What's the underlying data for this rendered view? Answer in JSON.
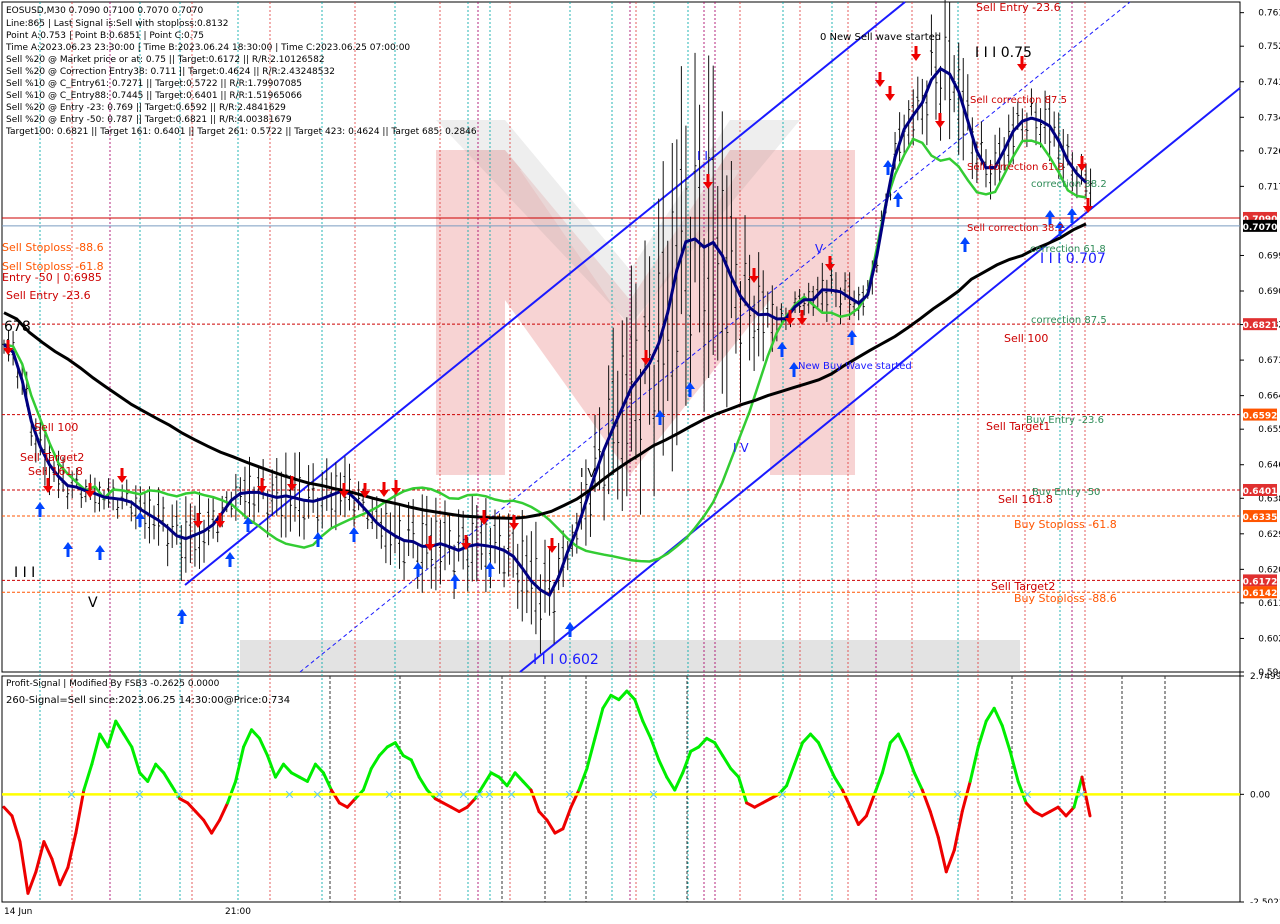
{
  "header": {
    "symbol_line": "EOSUSD,M30  0.7090 0.7100 0.7070 0.7070",
    "info_lines": [
      "Line:865 | Last Signal is:Sell with stoploss:0.8132",
      "Point A:0.753 | Point B:0.6851 | Point C:0.75",
      "Time A:2023.06.23 23:30:00 | Time B:2023.06.24 18:30:00 | Time C:2023.06.25 07:00:00",
      "Sell %20 @ Market price or at: 0.75 || Target:0.6172 || R/R:2.10126582",
      "Sell %20 @ Correction Entry38: 0.711 || Target:0.4624 || R/R:2.43248532",
      "Sell %10 @ C_Entry61: 0.7271 || Target:0.5722 || R/R:1.79907085",
      "Sell %10 @ C_Entry88: 0.7445 || Target:0.6401 || R/R:1.51965066",
      "Sell %20 @ Entry -23: 0.769 || Target:0.6592 || R/R:2.4841629",
      "Sell %20 @ Entry -50: 0.787 || Target:0.6821 || R/R:4.00381679",
      "Target100: 0.6821 || Target 161: 0.6401 || Target 261: 0.5722 || Target 423: 0.4624 || Target 685: 0.2846"
    ]
  },
  "colors": {
    "background": "#ffffff",
    "grid": "#c8c8c8",
    "buy_channel": "#1a1aff",
    "ma_green": "#33cc33",
    "ma_navy": "#000080",
    "ma_black": "#000000",
    "level_red": "#cc0000",
    "label_orange": "#ff5500",
    "label_green": "#2e8b57",
    "osc_positive": "#00ee00",
    "osc_negative": "#ee0000",
    "zero_line": "#ffff00",
    "v_red": "#e04040",
    "v_magenta": "#aa0066",
    "v_cyan": "#00aaaa",
    "watermark": "#e88080"
  },
  "chart_data": [
    {
      "type": "candlestick",
      "symbol": "EOSUSD",
      "timeframe": "M30",
      "ylim": [
        0.594,
        0.7637
      ],
      "y_ticks": [
        0.761,
        0.7525,
        0.7435,
        0.7345,
        0.726,
        0.717,
        0.6995,
        0.6905,
        0.682,
        0.673,
        0.664,
        0.6555,
        0.6465,
        0.638,
        0.629,
        0.62,
        0.6115,
        0.6025,
        0.594
      ],
      "current_price": "0.7070",
      "price_tags": [
        {
          "price": 0.709,
          "label": "0.7090",
          "bg": "#e03030"
        },
        {
          "price": 0.707,
          "label": "0.7070",
          "bg": "#000000"
        },
        {
          "price": 0.6821,
          "label": "0.6821",
          "bg": "#e03030"
        },
        {
          "price": 0.6592,
          "label": "0.6592",
          "bg": "#ff5500"
        },
        {
          "price": 0.6401,
          "label": "0.6401",
          "bg": "#e03030"
        },
        {
          "price": 0.6335,
          "label": "0.6335",
          "bg": "#ff5500"
        },
        {
          "price": 0.6172,
          "label": "0.6172",
          "bg": "#e03030"
        },
        {
          "price": 0.6142,
          "label": "0.6142",
          "bg": "#ff5500"
        }
      ],
      "horizontal_levels": [
        {
          "price": 0.709,
          "color": "#cc0000",
          "style": "solid"
        },
        {
          "price": 0.6821,
          "color": "#cc0000",
          "style": "dashed"
        },
        {
          "price": 0.6592,
          "color": "#cc0000",
          "style": "dashed"
        },
        {
          "price": 0.6401,
          "color": "#cc0000",
          "style": "dashed"
        },
        {
          "price": 0.6335,
          "color": "#ff5500",
          "style": "dashed"
        },
        {
          "price": 0.6172,
          "color": "#cc0000",
          "style": "dashed"
        },
        {
          "price": 0.6142,
          "color": "#ff5500",
          "style": "dashed"
        }
      ],
      "annotations": [
        {
          "text": "Sell Entry -23.6",
          "color": "#cc0000"
        },
        {
          "text": "0 New Sell wave started",
          "color": "#000000"
        },
        {
          "text": "I I I 0.75",
          "color": "#000000"
        },
        {
          "text": "Sell correction 87.5",
          "color": "#cc0000"
        },
        {
          "text": "Sell correction 61.8",
          "color": "#cc0000"
        },
        {
          "text": "correction 38.2",
          "color": "#2e8b57"
        },
        {
          "text": "Sell correction 38.2",
          "color": "#cc0000"
        },
        {
          "text": "correction 61.8",
          "color": "#2e8b57"
        },
        {
          "text": "I I I 0.707",
          "color": "#1a1aff"
        },
        {
          "text": "correction 87.5",
          "color": "#2e8b57"
        },
        {
          "text": "Sell 100",
          "color": "#cc0000"
        },
        {
          "text": "New Buy Wave started",
          "color": "#1a1aff"
        },
        {
          "text": "Buy Entry -23.6",
          "color": "#2e8b57"
        },
        {
          "text": "Sell Target1",
          "color": "#cc0000"
        },
        {
          "text": "Buy Entry -50",
          "color": "#2e8b57"
        },
        {
          "text": "Sell 161.8",
          "color": "#cc0000"
        },
        {
          "text": "Buy Stoploss -61.8",
          "color": "#ff5500"
        },
        {
          "text": "Sell Target2",
          "color": "#cc0000"
        },
        {
          "text": "Buy Stoploss -88.6",
          "color": "#ff5500"
        },
        {
          "text": "Sell Stoploss -88.6",
          "color": "#ff5500"
        },
        {
          "text": "Sell Stoploss -61.8",
          "color": "#ff5500"
        },
        {
          "text": "Entry -50 | 0.6985",
          "color": "#cc0000"
        },
        {
          "text": "Sell Entry -23.6",
          "color": "#cc0000"
        },
        {
          "text": "678",
          "color": "#000000"
        },
        {
          "text": "Sell 100",
          "color": "#cc0000"
        },
        {
          "text": "Sell Target2",
          "color": "#cc0000"
        },
        {
          "text": "Sell 161.8",
          "color": "#cc0000"
        },
        {
          "text": "I I I",
          "color": "#000000"
        },
        {
          "text": "V",
          "color": "#000000"
        },
        {
          "text": "I I I 0.602",
          "color": "#1a1aff"
        },
        {
          "text": "I I",
          "color": "#1a1aff"
        },
        {
          "text": "I V",
          "color": "#1a1aff"
        },
        {
          "text": "V",
          "color": "#1a1aff"
        },
        {
          "text": "I V",
          "color": "#000000"
        }
      ],
      "series": [
        {
          "name": "",
          "values": [
            0.677,
            0.6765,
            0.672,
            0.664,
            0.658,
            0.652,
            0.6468,
            0.6442,
            0.642,
            0.64,
            0.641,
            0.638,
            0.6402,
            0.64,
            0.6395,
            0.639,
            0.64,
            0.6398,
            0.639,
            0.6385,
            0.6392,
            0.6395,
            0.6388,
            0.6383,
            0.6375,
            0.6365,
            0.6345,
            0.6325,
            0.631,
            0.6292,
            0.6276,
            0.6265,
            0.626,
            0.6255,
            0.6262,
            0.6285,
            0.6304,
            0.6315,
            0.6326,
            0.6335,
            0.6345,
            0.6357,
            0.6372,
            0.6386,
            0.6398,
            0.6405,
            0.6407,
            0.6403,
            0.6393,
            0.638,
            0.6379,
            0.6388,
            0.6389,
            0.6385,
            0.6377,
            0.6372,
            0.6374,
            0.6368,
            0.6358,
            0.6344,
            0.6325,
            0.6302,
            0.6278,
            0.6258,
            0.6247,
            0.6242,
            0.6237,
            0.6233,
            0.6228,
            0.6223,
            0.6221,
            0.622,
            0.6227,
            0.624,
            0.6258,
            0.6278,
            0.6305,
            0.6335,
            0.637,
            0.642,
            0.648,
            0.654,
            0.66,
            0.667,
            0.674,
            0.68,
            0.684,
            0.687,
            0.689,
            0.687,
            0.685,
            0.685,
            0.684,
            0.6845,
            0.6862,
            0.69,
            0.7015,
            0.713,
            0.72,
            0.725,
            0.729,
            0.728,
            0.7248,
            0.7235,
            0.724,
            0.722,
            0.7186,
            0.7155,
            0.715,
            0.7156,
            0.72,
            0.7246,
            0.7285,
            0.7286,
            0.7278,
            0.7245,
            0.7206,
            0.716,
            0.7146,
            0.7142
          ]
        },
        {
          "name": "",
          "values": [
            0.677,
            0.675,
            0.6678,
            0.6575,
            0.651,
            0.6465,
            0.6435,
            0.6412,
            0.6408,
            0.6399,
            0.6392,
            0.6383,
            0.638,
            0.6377,
            0.637,
            0.6352,
            0.6338,
            0.6324,
            0.6306,
            0.6285,
            0.6278,
            0.6287,
            0.6297,
            0.6313,
            0.6343,
            0.6375,
            0.6392,
            0.6395,
            0.6395,
            0.6388,
            0.6382,
            0.6386,
            0.6381,
            0.6375,
            0.6372,
            0.6379,
            0.6388,
            0.6397,
            0.6392,
            0.637,
            0.6345,
            0.6318,
            0.63,
            0.6285,
            0.6273,
            0.627,
            0.6258,
            0.6259,
            0.6265,
            0.6257,
            0.6248,
            0.6258,
            0.6263,
            0.626,
            0.6256,
            0.6248,
            0.6233,
            0.6203,
            0.617,
            0.6148,
            0.6135,
            0.618,
            0.6245,
            0.63,
            0.637,
            0.644,
            0.6504,
            0.6558,
            0.6609,
            0.666,
            0.669,
            0.6722,
            0.6772,
            0.685,
            0.6958,
            0.703,
            0.7037,
            0.7016,
            0.7028,
            0.6995,
            0.694,
            0.6892,
            0.6863,
            0.6845,
            0.6846,
            0.6834,
            0.6835,
            0.6865,
            0.6883,
            0.6883,
            0.6908,
            0.6907,
            0.6903,
            0.6888,
            0.6874,
            0.6896,
            0.6995,
            0.7125,
            0.7245,
            0.7315,
            0.735,
            0.7382,
            0.744,
            0.7468,
            0.7455,
            0.741,
            0.7336,
            0.7258,
            0.7217,
            0.7218,
            0.7262,
            0.731,
            0.7335,
            0.7343,
            0.7336,
            0.7323,
            0.7285,
            0.7235,
            0.7202,
            0.718
          ]
        },
        {
          "name": "",
          "values": [
            0.685,
            0.6834,
            0.68,
            0.6775,
            0.6752,
            0.6733,
            0.671,
            0.6685,
            0.6662,
            0.664,
            0.6618,
            0.66,
            0.6582,
            0.6565,
            0.6545,
            0.6528,
            0.6512,
            0.6497,
            0.6485,
            0.6472,
            0.646,
            0.6448,
            0.6437,
            0.6427,
            0.6418,
            0.6412,
            0.6404,
            0.6398,
            0.6389,
            0.638,
            0.6372,
            0.6365,
            0.6357,
            0.635,
            0.6345,
            0.634,
            0.6335,
            0.6333,
            0.6331,
            0.633,
            0.6329,
            0.6332,
            0.6338,
            0.6347,
            0.6362,
            0.6378,
            0.64,
            0.6426,
            0.645,
            0.6472,
            0.6492,
            0.6513,
            0.6528,
            0.6545,
            0.6563,
            0.658,
            0.6594,
            0.6606,
            0.6618,
            0.6628,
            0.664,
            0.665,
            0.666,
            0.667,
            0.668,
            0.6695,
            0.6716,
            0.6735,
            0.6754,
            0.6772,
            0.679,
            0.6812,
            0.6835,
            0.686,
            0.6882,
            0.6905,
            0.6935,
            0.6953,
            0.6971,
            0.6985,
            0.6995,
            0.7012,
            0.7025,
            0.704,
            0.706,
            0.7075
          ]
        }
      ]
    },
    {
      "type": "line",
      "title": "Profit-Signal | Modified By FSB3 -0.2625 0.0000",
      "subtitle": "260-Signal=Sell since:2023.06.25 14:30:00@Price:0.734",
      "ylim": [
        -2.5022,
        2.7499
      ],
      "y_ticks": [
        "2.7499",
        "0.00",
        "-2.5022"
      ],
      "zero_line": 0,
      "series": [
        {
          "name": "",
          "values": [
            -0.3,
            -0.5,
            -1.1,
            -2.3,
            -1.8,
            -1.1,
            -1.5,
            -2.1,
            -1.7,
            -0.9,
            0.1,
            0.7,
            1.4,
            1.1,
            1.7,
            1.4,
            1.1,
            0.5,
            0.3,
            0.7,
            0.5,
            0.2,
            -0.1,
            -0.2,
            -0.4,
            -0.6,
            -0.9,
            -0.6,
            -0.2,
            0.3,
            1.1,
            1.5,
            1.3,
            0.9,
            0.4,
            0.7,
            0.5,
            0.4,
            0.3,
            0.7,
            0.5,
            0.1,
            -0.2,
            -0.3,
            -0.1,
            0.1,
            0.6,
            0.9,
            1.1,
            1.2,
            0.9,
            0.8,
            0.4,
            0.1,
            -0.1,
            -0.2,
            -0.3,
            -0.4,
            -0.3,
            -0.1,
            0.2,
            0.5,
            0.4,
            0.2,
            0.5,
            0.3,
            0.1,
            -0.4,
            -0.6,
            -0.9,
            -0.8,
            -0.3,
            0.1,
            0.6,
            1.3,
            2.0,
            2.3,
            2.2,
            2.4,
            2.2,
            1.7,
            1.3,
            0.8,
            0.4,
            0.1,
            0.5,
            1.0,
            1.1,
            1.3,
            1.2,
            0.9,
            0.6,
            0.4,
            -0.2,
            -0.3,
            -0.2,
            -0.1,
            0.0,
            0.2,
            0.7,
            1.2,
            1.4,
            1.2,
            0.8,
            0.4,
            0.1,
            -0.3,
            -0.7,
            -0.5,
            0.0,
            0.5,
            1.2,
            1.4,
            1.0,
            0.5,
            0.1,
            -0.4,
            -1.0,
            -1.8,
            -1.3,
            -0.4,
            0.3,
            1.1,
            1.7,
            2.0,
            1.6,
            1.0,
            0.3,
            -0.2,
            -0.4,
            -0.5,
            -0.4,
            -0.3,
            -0.5,
            -0.3,
            0.4,
            -0.5
          ]
        }
      ]
    }
  ],
  "time_axis": [
    {
      "label": "14 Jun",
      "highlight": "none"
    },
    {
      "label": "21:00",
      "highlight": "none"
    }
  ]
}
